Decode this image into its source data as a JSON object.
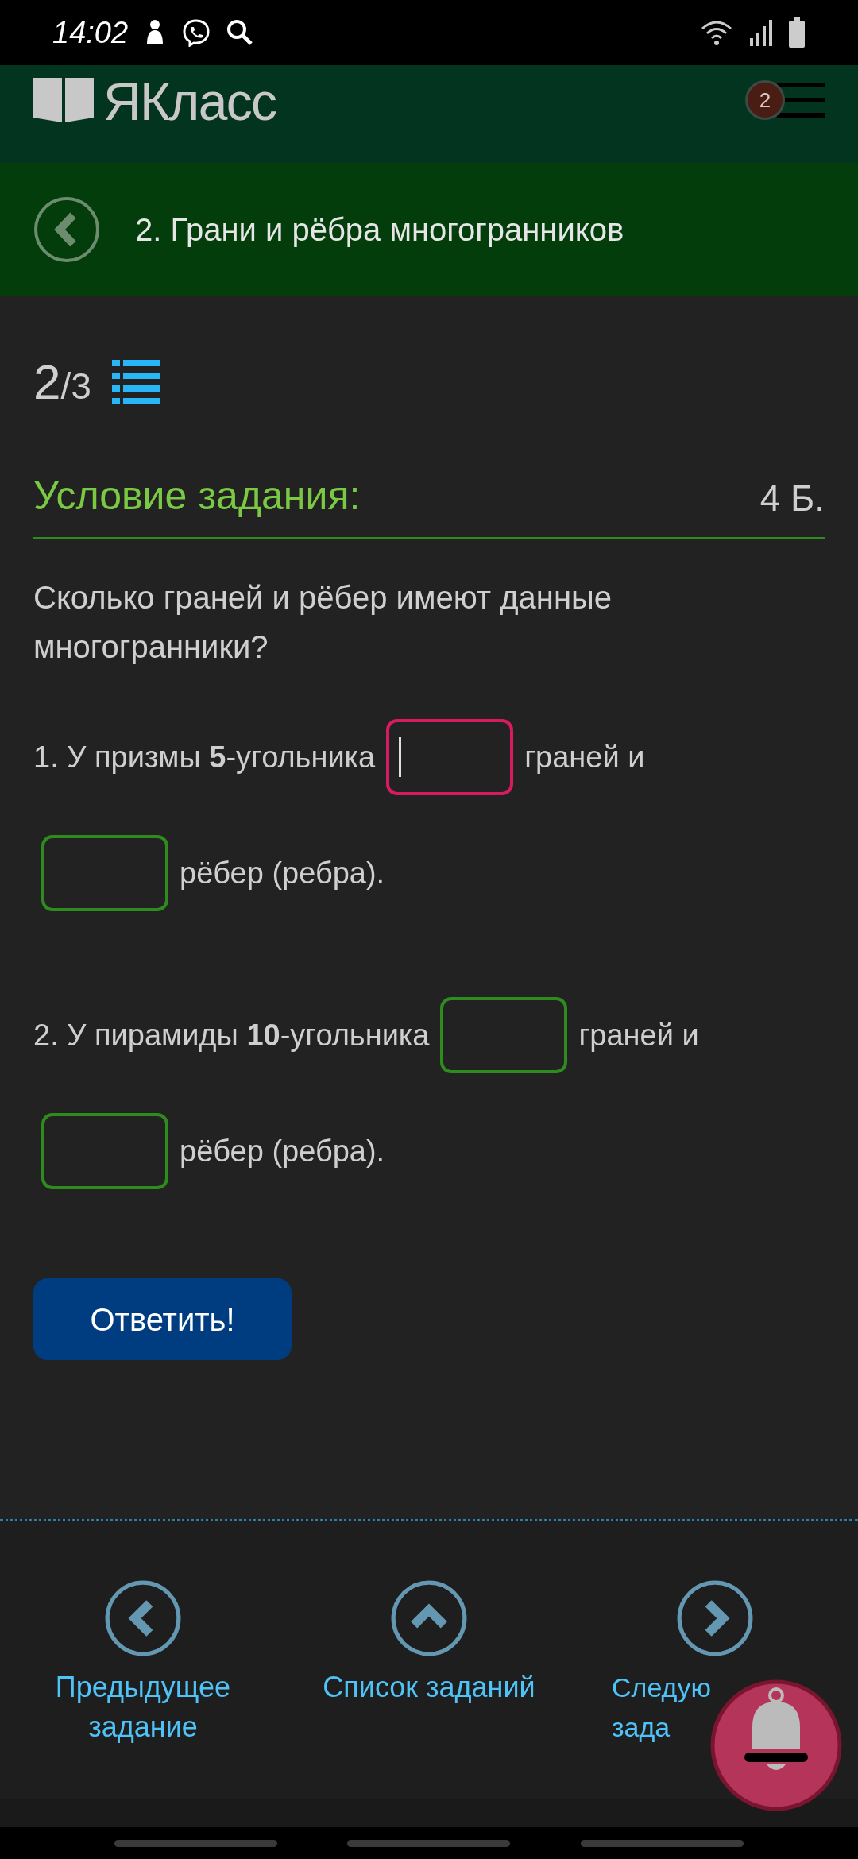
{
  "status_bar": {
    "time": "14:02"
  },
  "header": {
    "logo": "ЯКласс",
    "notification_count": "2"
  },
  "title_bar": {
    "title": "2. Грани и рёбра многогранников"
  },
  "progress": {
    "current": "2",
    "total": "/3"
  },
  "task": {
    "heading": "Условие задания:",
    "points": "4 Б.",
    "question": "Сколько граней и рёбер имеют данные многогранники?",
    "items": [
      {
        "text": "1. У призмы **5**-угольника",
        "after_first": "граней и",
        "after_second": "рёбер (ребра).",
        "inputs": [
          {
            "focused": true
          },
          {
            "focused": false
          }
        ]
      },
      {
        "text": "2. У пирамиды **10**-угольника",
        "after_first": "граней и",
        "after_second": "рёбер (ребра).",
        "inputs": [
          {
            "focused": false
          },
          {
            "focused": false
          }
        ]
      }
    ]
  },
  "submit_button": "Ответить!",
  "bottom_nav": [
    {
      "kind": "prev",
      "label": [
        "Предыдущее",
        "задание"
      ]
    },
    {
      "kind": "list",
      "label": [
        "Список заданий"
      ]
    },
    {
      "kind": "next",
      "label": [
        "Следую",
        "зада"
      ]
    }
  ]
}
